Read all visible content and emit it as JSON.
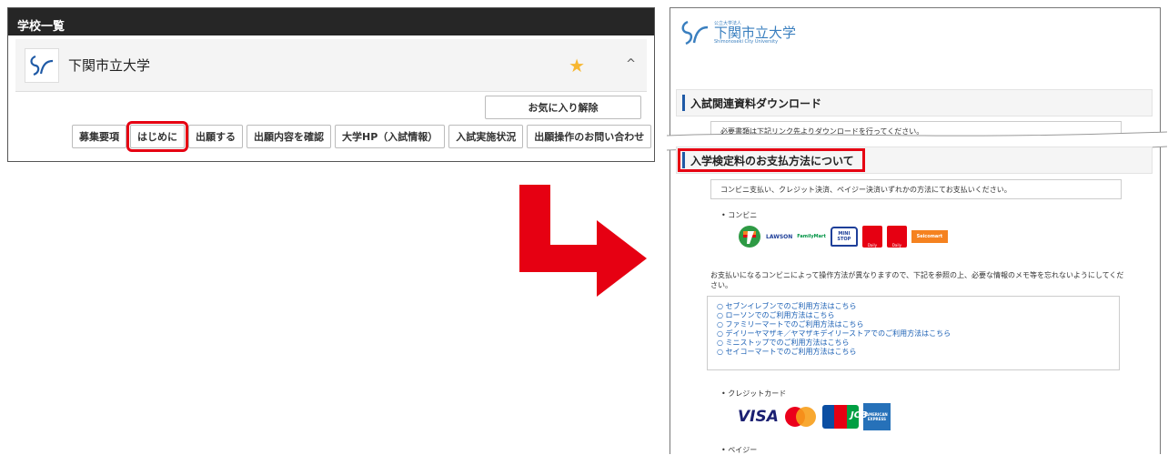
{
  "left": {
    "header": "学校一覧",
    "school_name": "下関市立大学",
    "star": "★",
    "caret": "^",
    "fav_button": "お気に入り解除",
    "buttons": [
      "募集要項",
      "はじめに",
      "出願する",
      "出願内容を確認",
      "大学HP（入試情報）",
      "入試実施状況",
      "出願操作のお問い合わせ"
    ],
    "highlighted_button_index": 1
  },
  "right": {
    "logo": {
      "small": "公立大学法人",
      "name": "下関市立大学",
      "en": "Shimonoseki City University"
    },
    "section1": {
      "title": "入試関連資料ダウンロード",
      "note": "必要書類は下記リンク先よりダウンロードを行ってください。"
    },
    "section2": {
      "title": "入学検定料のお支払方法について",
      "note": "コンビニ支払い、クレジット決済、ペイジー決済いずれかの方法にてお支払いください。",
      "conv_label": "• コンビニ",
      "conv_logos": [
        "LAWSON",
        "FamilyMart",
        "MINI STOP",
        "Daily",
        "Daily",
        "Seicomart"
      ],
      "instruction": "お支払いになるコンビニによって操作方法が異なりますので、下記を参照の上、必要な情報のメモ等を忘れないようにしてください。",
      "links": [
        "セブンイレブンでのご利用方法はこちら",
        "ローソンでのご利用方法はこちら",
        "ファミリーマートでのご利用方法はこちら",
        "デイリーヤマザキ／ヤマザキデイリーストアでのご利用方法はこちら",
        "ミニストップでのご利用方法はこちら",
        "セイコーマートでのご利用方法はこちら"
      ],
      "credit_label": "• クレジットカード",
      "card_logos": [
        "VISA",
        "JCB",
        "AMERICAN EXPRESS"
      ],
      "payeasy_label": "• ペイジー"
    }
  },
  "colors": {
    "highlight": "#e60012",
    "header_bg": "#262626",
    "link": "#1a5fb4",
    "star": "#f7b731"
  }
}
